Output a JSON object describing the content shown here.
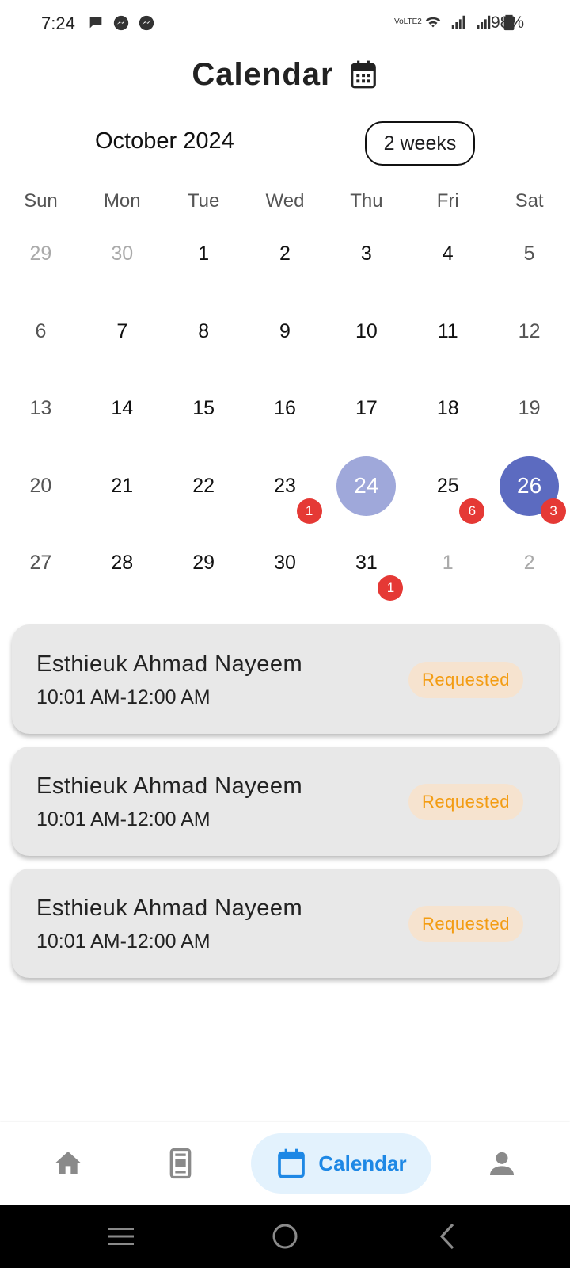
{
  "status_bar": {
    "time": "7:24",
    "battery_percent": "98%",
    "network_label": "VoLTE2"
  },
  "header": {
    "title": "Calendar",
    "icon": "calendar-icon"
  },
  "calendar": {
    "month_label": "October 2024",
    "range_toggle": "2 weeks",
    "weekdays": [
      "Sun",
      "Mon",
      "Tue",
      "Wed",
      "Thu",
      "Fri",
      "Sat"
    ],
    "weeks": [
      [
        {
          "day": "29",
          "outside": true
        },
        {
          "day": "30",
          "outside": true
        },
        {
          "day": "1"
        },
        {
          "day": "2"
        },
        {
          "day": "3"
        },
        {
          "day": "4"
        },
        {
          "day": "5"
        }
      ],
      [
        {
          "day": "6"
        },
        {
          "day": "7"
        },
        {
          "day": "8"
        },
        {
          "day": "9"
        },
        {
          "day": "10"
        },
        {
          "day": "11"
        },
        {
          "day": "12"
        }
      ],
      [
        {
          "day": "13"
        },
        {
          "day": "14"
        },
        {
          "day": "15"
        },
        {
          "day": "16"
        },
        {
          "day": "17"
        },
        {
          "day": "18"
        },
        {
          "day": "19"
        }
      ],
      [
        {
          "day": "20"
        },
        {
          "day": "21"
        },
        {
          "day": "22"
        },
        {
          "day": "23",
          "badge": "1"
        },
        {
          "day": "24",
          "today": true
        },
        {
          "day": "25",
          "badge": "6"
        },
        {
          "day": "26",
          "selected": true,
          "badge": "3"
        }
      ],
      [
        {
          "day": "27"
        },
        {
          "day": "28"
        },
        {
          "day": "29"
        },
        {
          "day": "30"
        },
        {
          "day": "31",
          "badge": "1"
        },
        {
          "day": "1",
          "outside": true
        },
        {
          "day": "2",
          "outside": true
        }
      ]
    ],
    "colors": {
      "today": "#9fa8da",
      "selected": "#5c6bc0",
      "badge": "#e53935"
    }
  },
  "appointments": [
    {
      "name": "Esthieuk Ahmad Nayeem",
      "time": "10:01 AM-12:00 AM",
      "status": "Requested"
    },
    {
      "name": "Esthieuk Ahmad Nayeem",
      "time": "10:01 AM-12:00 AM",
      "status": "Requested"
    },
    {
      "name": "Esthieuk Ahmad Nayeem",
      "time": "10:01 AM-12:00 AM",
      "status": "Requested"
    }
  ],
  "status_colors": {
    "requested_text": "#f39c12",
    "requested_bg": "#f6e3cf"
  },
  "bottom_nav": {
    "items": [
      {
        "icon": "home-icon",
        "label": ""
      },
      {
        "icon": "tickets-icon",
        "label": ""
      },
      {
        "icon": "calendar-icon",
        "label": "Calendar",
        "active": true
      },
      {
        "icon": "person-icon",
        "label": ""
      }
    ],
    "active_color": "#1e88e5"
  }
}
